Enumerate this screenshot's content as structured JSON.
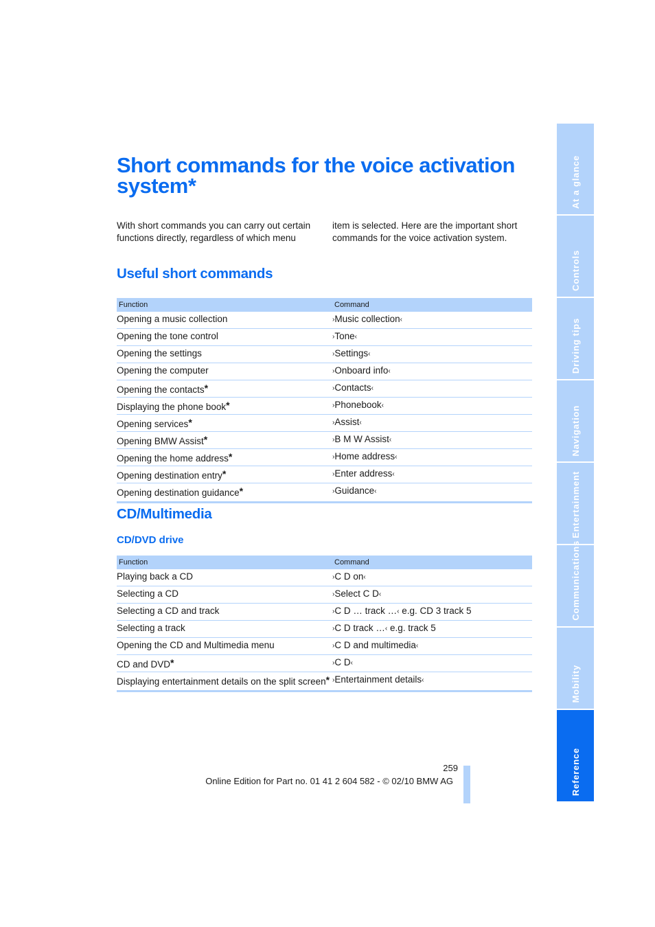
{
  "page": {
    "title": "Short commands for the voice activation system*",
    "intro_left": "With short commands you can carry out certain functions directly, regardless of which menu",
    "intro_right": "item is selected. Here are the important short commands for the voice activation system.",
    "page_number": "259",
    "footer": "Online Edition for Part no. 01 41 2 604 582 - © 02/10 BMW AG"
  },
  "sections": {
    "useful": {
      "heading": "Useful short commands",
      "col_function": "Function",
      "col_command": "Command",
      "rows": [
        {
          "function": "Opening a music collection",
          "star": false,
          "command": "Music collection"
        },
        {
          "function": "Opening the tone control",
          "star": false,
          "command": "Tone"
        },
        {
          "function": "Opening the settings",
          "star": false,
          "command": "Settings"
        },
        {
          "function": "Opening the computer",
          "star": false,
          "command": "Onboard info"
        },
        {
          "function": "Opening the contacts",
          "star": true,
          "command": "Contacts"
        },
        {
          "function": "Displaying the phone book",
          "star": true,
          "command": "Phonebook"
        },
        {
          "function": "Opening services",
          "star": true,
          "command": "Assist"
        },
        {
          "function": "Opening BMW Assist",
          "star": true,
          "command": "B M W Assist"
        },
        {
          "function": "Opening the home address",
          "star": true,
          "command": "Home address"
        },
        {
          "function": "Opening destination entry",
          "star": true,
          "command": "Enter address"
        },
        {
          "function": "Opening destination guidance",
          "star": true,
          "command": "Guidance"
        }
      ]
    },
    "cd": {
      "heading": "CD/Multimedia",
      "subheading": "CD/DVD drive",
      "col_function": "Function",
      "col_command": "Command",
      "rows": [
        {
          "function": "Playing back a CD",
          "star": false,
          "command": "C D on",
          "note": ""
        },
        {
          "function": "Selecting a CD",
          "star": false,
          "command": "Select C D",
          "note": ""
        },
        {
          "function": "Selecting a CD and track",
          "star": false,
          "command": "C D … track …",
          "note": " e.g. CD 3 track 5"
        },
        {
          "function": "Selecting a track",
          "star": false,
          "command": "C D track …",
          "note": " e.g. track 5"
        },
        {
          "function": "Opening the CD and Multimedia menu",
          "star": false,
          "command": "C D and multimedia",
          "note": ""
        },
        {
          "function": "CD and DVD",
          "star": true,
          "command": "C D",
          "note": ""
        },
        {
          "function": "Displaying entertainment details on the split screen",
          "star": true,
          "command": "Entertainment details",
          "note": ""
        }
      ]
    }
  },
  "side_tabs": [
    {
      "label": "At a glance",
      "active": false
    },
    {
      "label": "Controls",
      "active": false
    },
    {
      "label": "Driving tips",
      "active": false
    },
    {
      "label": "Navigation",
      "active": false
    },
    {
      "label": "Entertainment",
      "active": false
    },
    {
      "label": "Communications",
      "active": false
    },
    {
      "label": "Mobility",
      "active": false
    },
    {
      "label": "Reference",
      "active": true
    }
  ],
  "glyphs": {
    "quote_open": "›",
    "quote_close": "‹",
    "asterisk": "*"
  },
  "colors": {
    "accent": "#0a6cf0",
    "light_accent": "#b3d3fb"
  }
}
